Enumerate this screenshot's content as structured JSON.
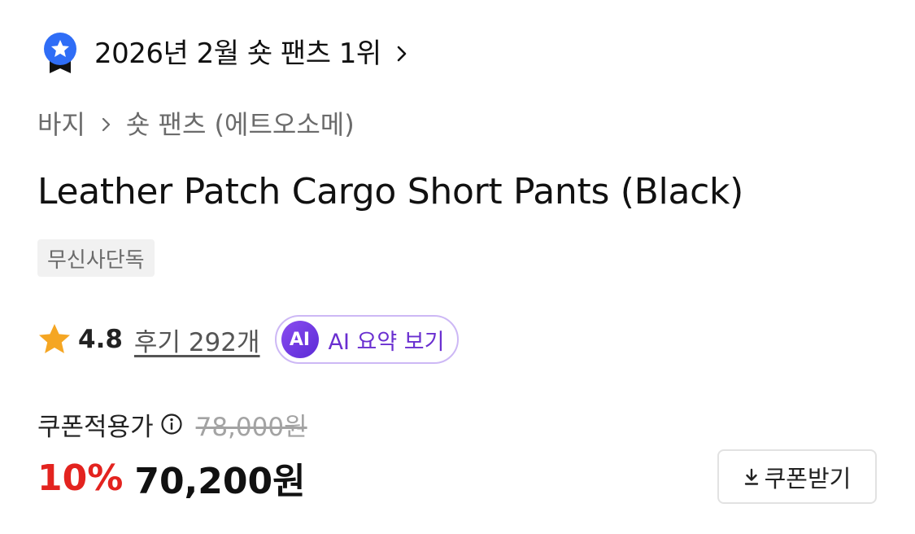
{
  "ranking": {
    "text": "2026년 2월 숏 팬츠 1위",
    "icon": "medal-star-icon",
    "accent_color": "#2f6df6"
  },
  "breadcrumb": {
    "items": [
      "바지",
      "숏 팬츠 (에트오소메)"
    ]
  },
  "product": {
    "title": "Leather Patch Cargo Short Pants (Black)",
    "badge": "무신사단독"
  },
  "rating": {
    "value": "4.8",
    "reviews_label": "후기 292개",
    "star_color": "#f5a623",
    "ai_badge": "AI",
    "ai_button_label": "AI 요약 보기"
  },
  "price": {
    "coupon_label": "쿠폰적용가",
    "original": "78,000원",
    "discount": "10%",
    "sale": "70,200원",
    "coupon_button_label": "쿠폰받기",
    "discount_color": "#e3231f"
  }
}
